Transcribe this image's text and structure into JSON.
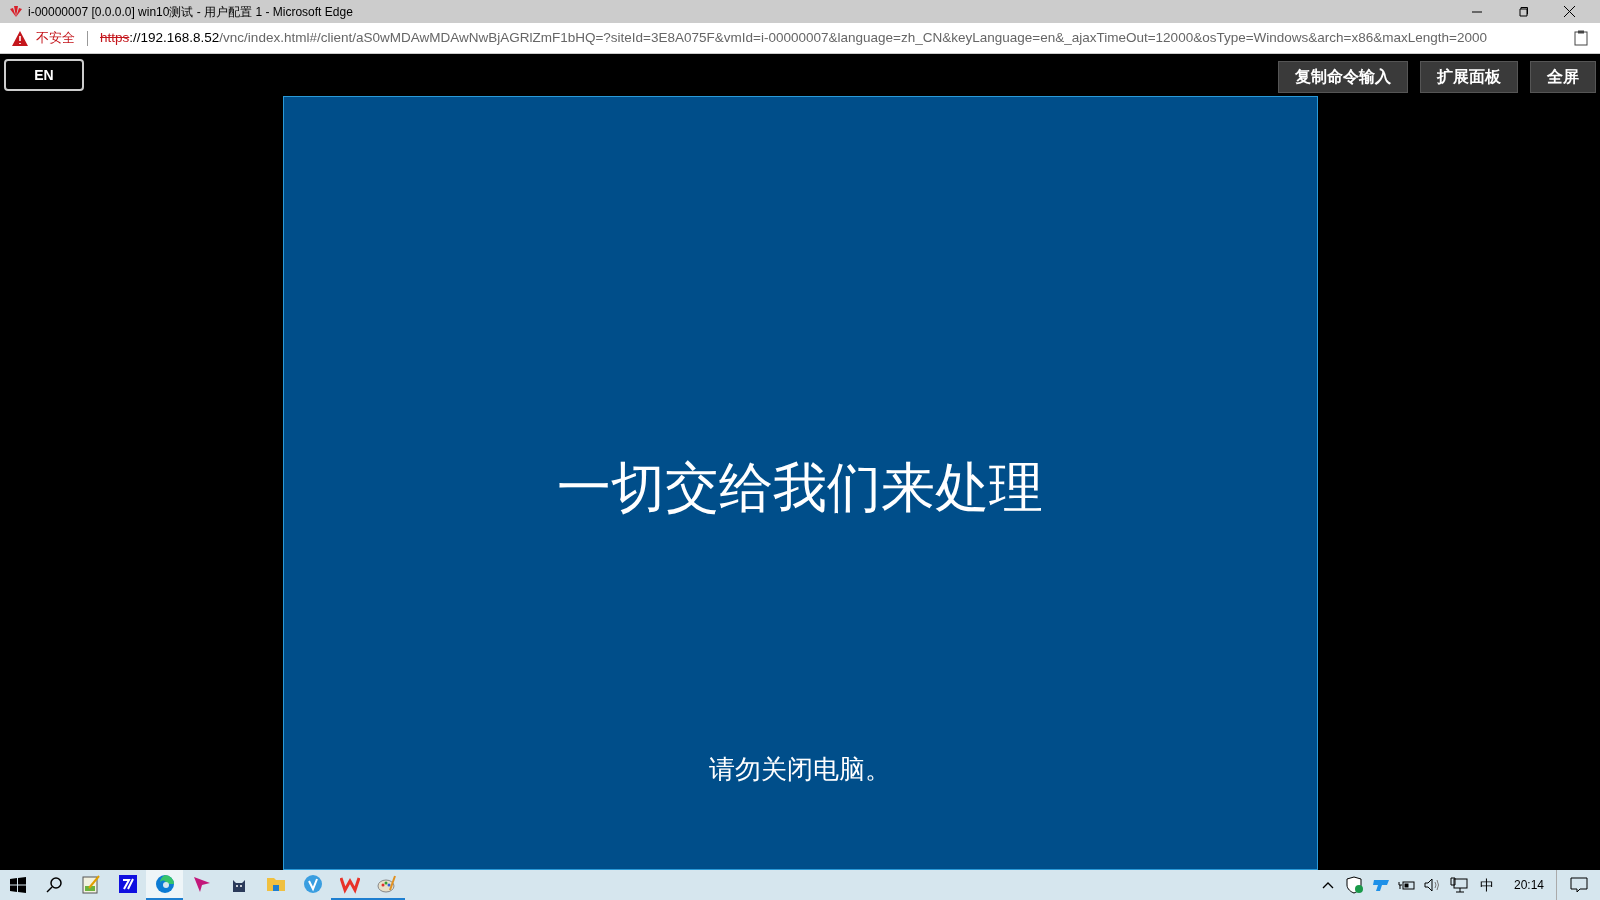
{
  "window": {
    "title": "i-00000007 [0.0.0.0] win10测试 - 用户配置 1 - Microsoft Edge"
  },
  "address_bar": {
    "security": "不安全",
    "scheme": "https",
    "host": "://192.168.8.52",
    "path": "/vnc/index.html#/client/aS0wMDAwMDAwNwBjAGRlZmF1bHQ=?siteId=3E8A075F&vmId=i-00000007&language=zh_CN&keyLanguage=en&_ajaxTimeOut=12000&osType=Windows&arch=x86&maxLength=2000"
  },
  "toolbar": {
    "language_button": "EN",
    "buttons": [
      "复制命令输入",
      "扩展面板",
      "全屏"
    ]
  },
  "vm_screen": {
    "headline": "一切交给我们来处理",
    "message": "请勿关闭电脑。"
  },
  "taskbar": {
    "apps": [
      {
        "kind": "notepad",
        "running": false,
        "selected": false
      },
      {
        "kind": "typing",
        "running": false,
        "selected": false
      },
      {
        "kind": "edge",
        "running": true,
        "selected": true
      },
      {
        "kind": "plane",
        "running": false,
        "selected": false
      },
      {
        "kind": "cat",
        "running": false,
        "selected": false
      },
      {
        "kind": "folder",
        "running": false,
        "selected": false
      },
      {
        "kind": "v",
        "running": false,
        "selected": false
      },
      {
        "kind": "wps",
        "running": true,
        "selected": false
      },
      {
        "kind": "paint",
        "running": true,
        "selected": false
      }
    ],
    "ime": "中",
    "clock": "20:14"
  }
}
